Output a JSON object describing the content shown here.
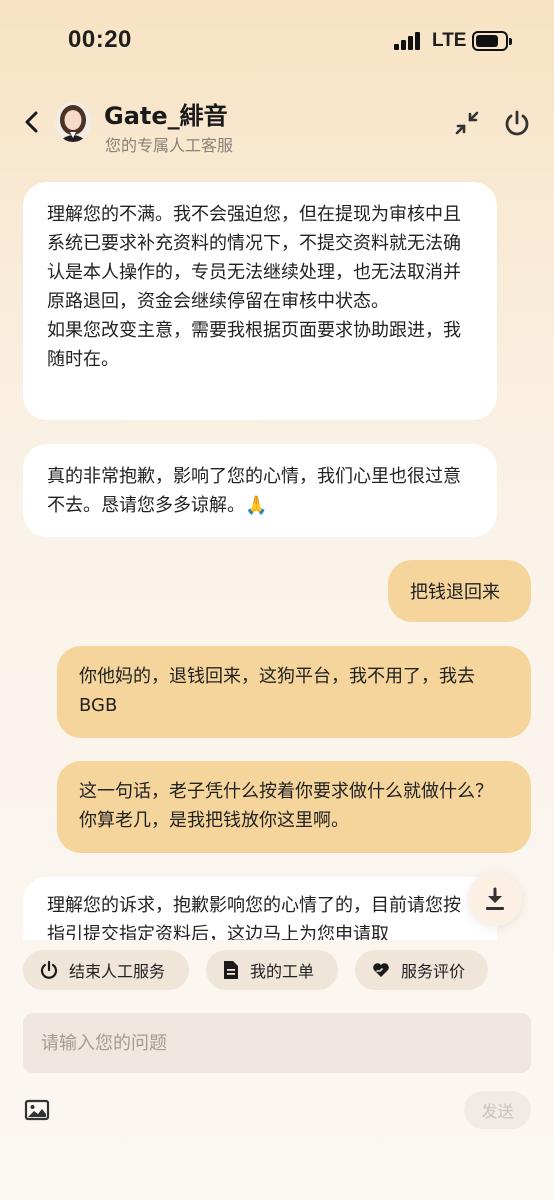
{
  "status_bar": {
    "time": "00:20",
    "network": "LTE"
  },
  "header": {
    "agent_name": "Gate_緋音",
    "agent_subtitle": "您的专属人工客服"
  },
  "messages": [
    {
      "side": "left",
      "text": "理解您的不满。我不会强迫您，但在提现为审核中且系统已要求补充资料的情况下，不提交资料就无法确认是本人操作的，专员无法继续处理，也无法取消并原路退回，资金会继续停留在审核中状态。\n如果您改变主意，需要我根据页面要求协助跟进，我随时在。"
    },
    {
      "side": "left",
      "text": "真的非常抱歉，影响了您的心情，我们心里也很过意不去。恳请您多多谅解。🙏"
    },
    {
      "side": "right",
      "text": "把钱退回来"
    },
    {
      "side": "right",
      "text": "你他妈的，退钱回来，这狗平台，我不用了，我去BGB"
    },
    {
      "side": "right",
      "text": "这一句话，老子凭什么按着你要求做什么就做什么？你算老几，是我把钱放你这里啊。"
    },
    {
      "side": "left",
      "text": "理解您的诉求，抱歉影响您的心情了的，目前请您按指引提交指定资料后，这边马上为您申请取"
    }
  ],
  "quick_actions": {
    "end_service": "结束人工服务",
    "my_tickets": "我的工单",
    "rate_service": "服务评价"
  },
  "input": {
    "placeholder": "请输入您的问题",
    "value": ""
  },
  "send_label": "发送",
  "colors": {
    "user_bubble": "#f6d59c",
    "agent_bubble": "#ffffff",
    "accent": "#f6d59c"
  },
  "icons": [
    "back-icon",
    "agent-avatar",
    "minimize-icon",
    "power-icon",
    "download-icon",
    "power-icon",
    "document-icon",
    "heart-hand-icon",
    "image-icon"
  ]
}
